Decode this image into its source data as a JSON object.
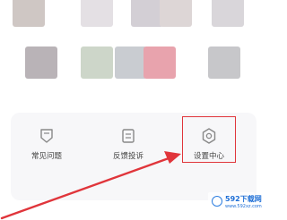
{
  "app_grid": {
    "row1": [
      {
        "color": "#cfc7c4"
      },
      {
        "color": "#e4e0e4"
      },
      {
        "color": "#d3cfd5"
      },
      {
        "color": "#ddd6d6"
      },
      {
        "color": "#d9d6da"
      }
    ],
    "row2": [
      {
        "color": "#b9b3b7"
      },
      {
        "color": "#cdd6c9"
      },
      {
        "color": "#c9ccd1"
      },
      {
        "color": "#e8a3ad"
      },
      {
        "color": "#c7c7ca"
      }
    ]
  },
  "services": [
    {
      "label": "常见问题",
      "icon": "faq-icon"
    },
    {
      "label": "反馈投诉",
      "icon": "feedback-icon"
    },
    {
      "label": "设置中心",
      "icon": "settings-gear-icon"
    }
  ],
  "annotation": {
    "color": "#e0353b",
    "target": "设置中心"
  },
  "watermark": {
    "brand": "592下载网",
    "url": "www.592xz.com"
  },
  "colors": {
    "card_bg": "#f7f7f9",
    "icon_stroke": "#888888",
    "text": "#444444"
  }
}
